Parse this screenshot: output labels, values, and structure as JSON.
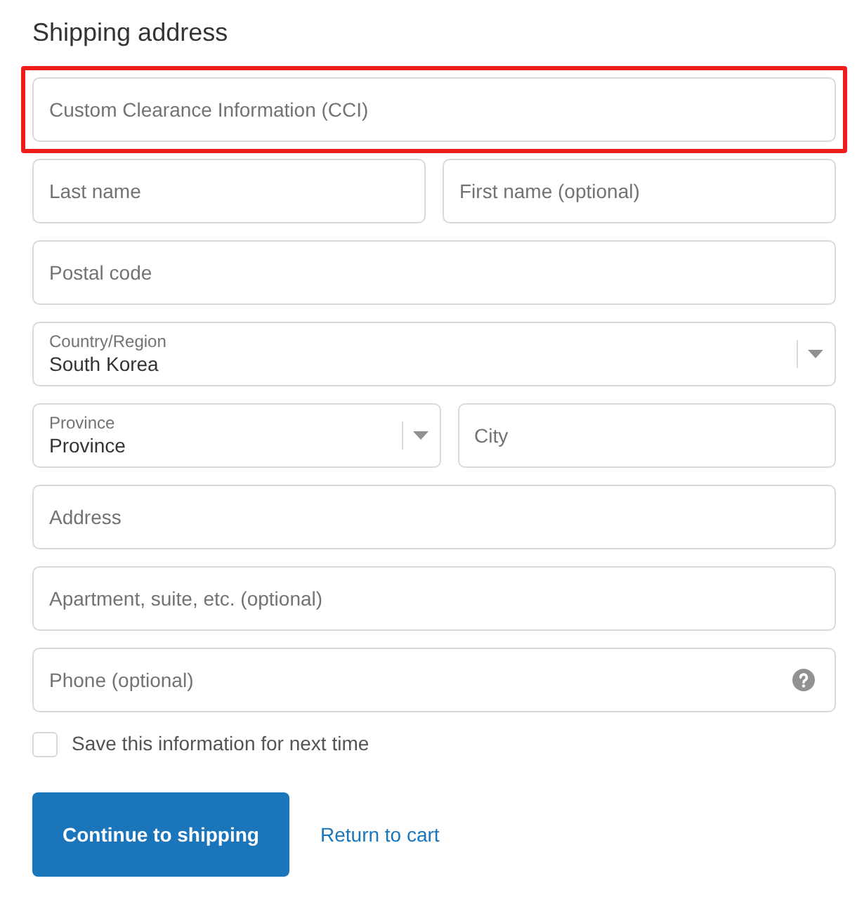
{
  "heading": "Shipping address",
  "rows": [
    {
      "highlighted": true,
      "fields": [
        {
          "kind": "text",
          "placeholder": "Custom Clearance Information (CCI)"
        }
      ]
    },
    {
      "highlighted": false,
      "fields": [
        {
          "kind": "text",
          "placeholder": "Last name"
        },
        {
          "kind": "text",
          "placeholder": "First name (optional)"
        }
      ]
    },
    {
      "highlighted": false,
      "fields": [
        {
          "kind": "text",
          "placeholder": "Postal code"
        }
      ]
    },
    {
      "highlighted": false,
      "fields": [
        {
          "kind": "select",
          "label": "Country/Region",
          "value": "South Korea"
        }
      ]
    },
    {
      "highlighted": false,
      "fields": [
        {
          "kind": "select",
          "label": "Province",
          "value": "Province"
        },
        {
          "kind": "text",
          "placeholder": "City"
        }
      ]
    },
    {
      "highlighted": false,
      "fields": [
        {
          "kind": "text",
          "placeholder": "Address"
        }
      ]
    },
    {
      "highlighted": false,
      "fields": [
        {
          "kind": "text",
          "placeholder": "Apartment, suite, etc. (optional)"
        }
      ]
    },
    {
      "highlighted": false,
      "fields": [
        {
          "kind": "help",
          "placeholder": "Phone (optional)"
        }
      ]
    }
  ],
  "save_info": {
    "label": "Save this information for next time",
    "checked": false
  },
  "primary_button": "Continue to shipping",
  "back_link": "Return to cart"
}
